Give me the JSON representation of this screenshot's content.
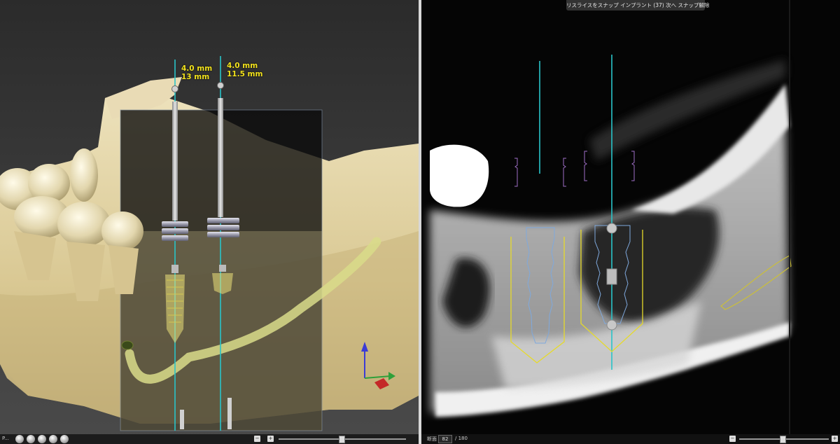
{
  "left_view": {
    "implant_1": {
      "diameter": "4.0 mm",
      "length": "13 mm"
    },
    "implant_2": {
      "diameter": "4.0 mm",
      "length": "11.5 mm"
    },
    "bottom_label": "P..."
  },
  "right_view": {
    "snap_toolbar": {
      "text": "リスライスをスナップ",
      "implant": "インプラント (37)",
      "next": "次へ",
      "release": "スナップ解除"
    },
    "slice_label": "断面",
    "slice_current": "82",
    "slice_total": "/ 180"
  },
  "colors": {
    "axis_line": "#29c4c9",
    "measure_text": "#f2e21c",
    "nerve_canal": "#d9dc8a",
    "implant_outline": "#7fa9dd",
    "safety_zone": "#e6da2a",
    "crown_marker": "#a070c8"
  }
}
